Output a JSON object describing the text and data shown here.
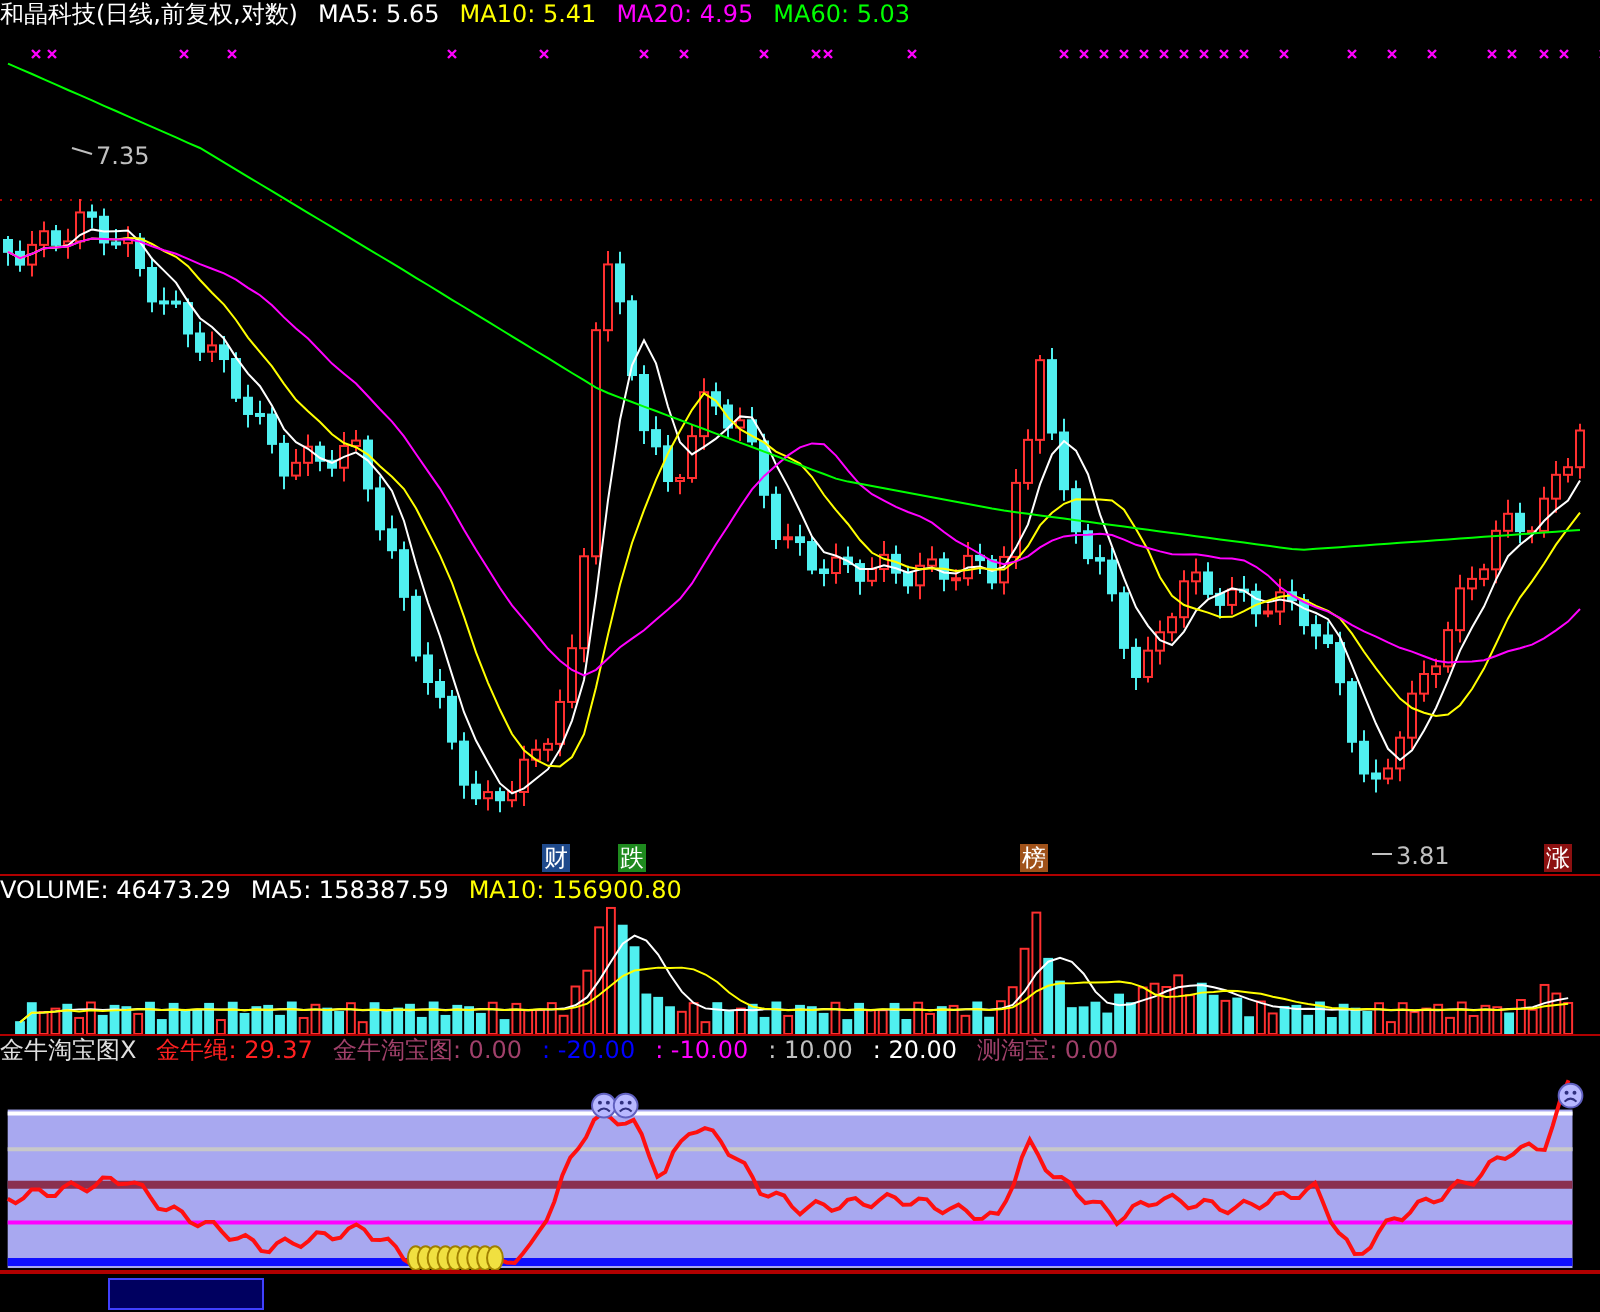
{
  "price_panel": {
    "title": "和晶科技(日线,前复权,对数)",
    "indicators": [
      {
        "label": "MA5: 5.65",
        "color": "#ffffff"
      },
      {
        "label": "MA10: 5.41",
        "color": "#ffff00"
      },
      {
        "label": "MA20: 4.95",
        "color": "#ff00ff"
      },
      {
        "label": "MA60: 5.03",
        "color": "#00ff00"
      }
    ],
    "high_label": "7.35",
    "low_label": "3.81",
    "tags": [
      {
        "text": "财",
        "color": "#1f4a8c"
      },
      {
        "text": "跌",
        "color": "#1e8a1e"
      },
      {
        "text": "榜",
        "color": "#a0521a"
      },
      {
        "text": "涨",
        "color": "#8c1010"
      }
    ]
  },
  "volume_panel": {
    "indicators": [
      {
        "label": "VOLUME: 46473.29",
        "color": "#ffffff"
      },
      {
        "label": "MA5: 158387.59",
        "color": "#ffffff"
      },
      {
        "label": "MA10: 156900.80",
        "color": "#ffff00"
      }
    ]
  },
  "indicator_panel": {
    "title": "金牛淘宝图X",
    "indicators": [
      {
        "label": "金牛绳: 29.37",
        "color": "#ff2020"
      },
      {
        "label": "金牛淘宝图: 0.00",
        "color": "#a0406a"
      },
      {
        "label": ": -20.00",
        "color": "#0000ff"
      },
      {
        "label": ": -10.00",
        "color": "#ff00ff"
      },
      {
        "label": ": 10.00",
        "color": "#c0c0c0"
      },
      {
        "label": ": 20.00",
        "color": "#ffffff"
      },
      {
        "label": "测淘宝: 0.00",
        "color": "#a0406a"
      }
    ]
  }
}
